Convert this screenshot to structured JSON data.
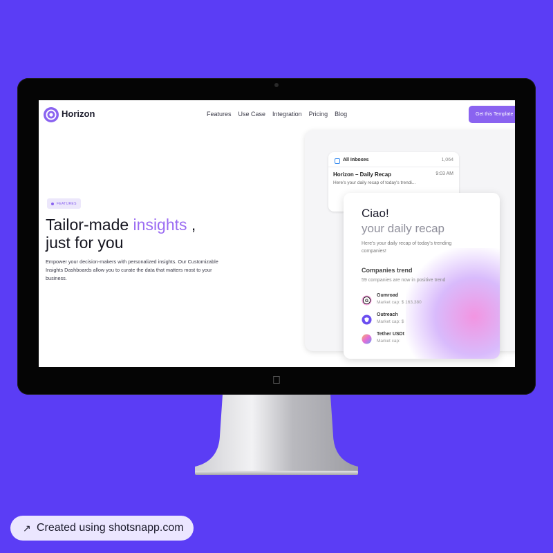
{
  "nav": {
    "brand": "Horizon",
    "links": [
      "Features",
      "Use Case",
      "Integration",
      "Pricing",
      "Blog"
    ],
    "cta": "Get this Template"
  },
  "hero": {
    "badge": "FEATURES",
    "headline_part1": "Tailor-made ",
    "headline_accent": "insights",
    "headline_part2": " ,",
    "headline_line2": "just for you",
    "body": "Empower your decision-makers with personalized insights. Our Customizable Insights Dashboards allow you to curate the data that matters most to your business."
  },
  "inbox": {
    "label": "All Inboxes",
    "count": "1,064",
    "sender": "Horizon – Daily Recap",
    "time": "9:03 AM",
    "preview": "Here's your daily recap of today's trendi..."
  },
  "recap": {
    "greeting": "Ciao!",
    "title": "your daily recap",
    "description": "Here's your daily recap of today's trending companies!",
    "trend_title": "Companies trend",
    "trend_subtitle": "59 companies are now in positive trend",
    "companies": [
      {
        "name": "Gumroad",
        "cap": "Market cap: $ 163,380"
      },
      {
        "name": "Outreach",
        "cap": "Market cap: $"
      },
      {
        "name": "Tether USDt",
        "cap": "Market cap:"
      }
    ]
  },
  "footer": {
    "credit": "Created using shotsnapp.com"
  },
  "colors": {
    "background": "#5b3df5",
    "accent": "#9b6cf2",
    "cta": "#8a63f0"
  }
}
